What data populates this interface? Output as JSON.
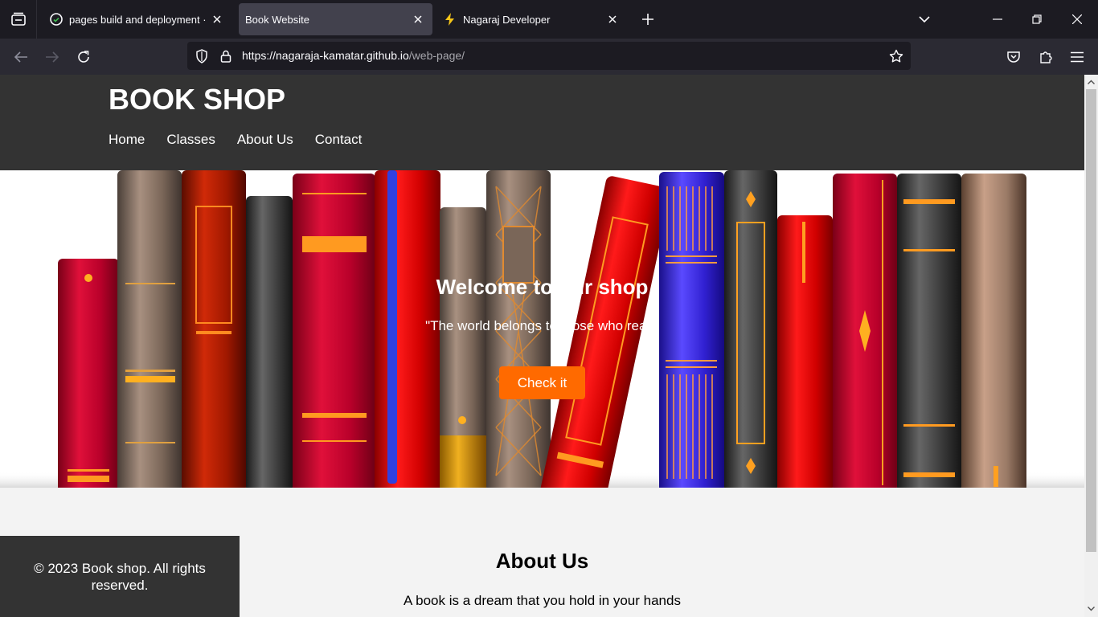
{
  "browser": {
    "tabs": [
      {
        "title": "pages build and deployment · Nagaraja-Kamatar/web-page",
        "favicon": "github-icon",
        "active": false
      },
      {
        "title": "Book Website",
        "favicon": "",
        "active": true
      },
      {
        "title": "Nagaraj Developer",
        "favicon": "lightning-icon",
        "active": false
      }
    ],
    "url": {
      "host": "https://nagaraja-kamatar.github.io",
      "path": "/web-page/"
    }
  },
  "site": {
    "title": "BOOK SHOP",
    "nav": [
      "Home",
      "Classes",
      "About Us",
      "Contact"
    ],
    "hero": {
      "title": "Welcome to our shop",
      "quote": "\"The world belongs to those who read\"",
      "button": "Check it"
    },
    "about": {
      "title": "About Us",
      "text": "A book is a dream that you hold in your hands"
    },
    "footer": "© 2023 Book shop. All rights reserved."
  },
  "colors": {
    "header_bg": "#333333",
    "accent": "#ff6a00",
    "page_bg": "#f3f3f3",
    "browser_dark": "#1c1b22"
  }
}
